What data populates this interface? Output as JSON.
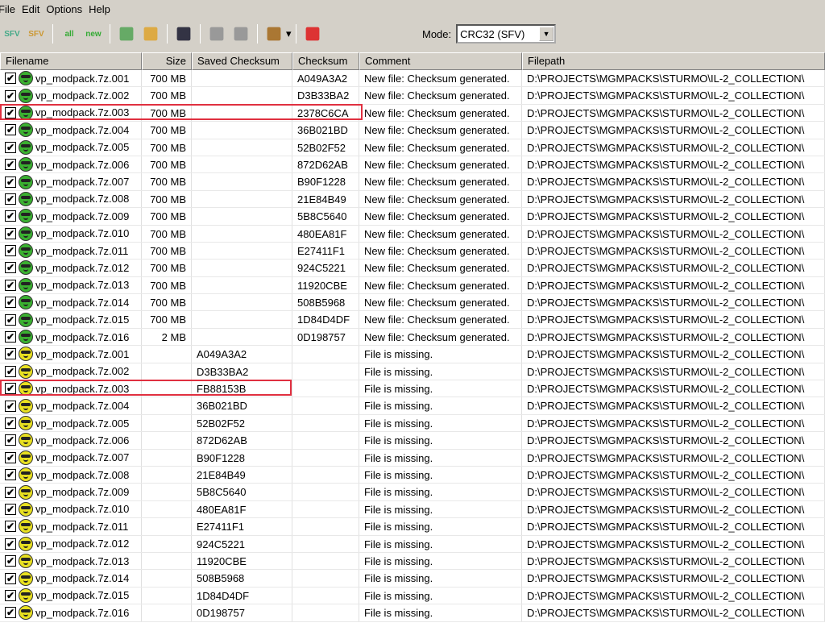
{
  "menu": [
    "File",
    "Edit",
    "Options",
    "Help"
  ],
  "toolbar": {
    "buttons": [
      {
        "name": "new-sfv-icon",
        "label": "SFV"
      },
      {
        "name": "open-sfv-icon",
        "label": "SFV"
      },
      {
        "name": "check-all-icon",
        "label": "all"
      },
      {
        "name": "check-new-icon",
        "label": "new"
      },
      {
        "name": "add-files-icon",
        "label": ""
      },
      {
        "name": "add-folder-icon",
        "label": ""
      },
      {
        "name": "save-icon",
        "label": ""
      },
      {
        "name": "check-selected-icon",
        "label": ""
      },
      {
        "name": "uncheck-icon",
        "label": ""
      },
      {
        "name": "clean-icon",
        "label": ""
      },
      {
        "name": "pin-icon",
        "label": ""
      }
    ],
    "mode_label": "Mode:",
    "mode_value": "CRC32 (SFV)"
  },
  "columns": [
    "Filename",
    "Size",
    "Saved Checksum",
    "Checksum",
    "Comment",
    "Filepath"
  ],
  "colors": {
    "ok": "#3ab030",
    "missing": "#e8e020",
    "highlight": "#e03040"
  },
  "rows": [
    {
      "file": "vp_modpack.7z.001",
      "size": "700 MB",
      "saved": "",
      "checksum": "A049A3A2",
      "comment": "New file: Checksum generated.",
      "path": "D:\\PROJECTS\\MGMPACKS\\STURMO\\IL-2_COLLECTION\\",
      "status": "ok"
    },
    {
      "file": "vp_modpack.7z.002",
      "size": "700 MB",
      "saved": "",
      "checksum": "D3B33BA2",
      "comment": "New file: Checksum generated.",
      "path": "D:\\PROJECTS\\MGMPACKS\\STURMO\\IL-2_COLLECTION\\",
      "status": "ok"
    },
    {
      "file": "vp_modpack.7z.003",
      "size": "700 MB",
      "saved": "",
      "checksum": "2378C6CA",
      "comment": "New file: Checksum generated.",
      "path": "D:\\PROJECTS\\MGMPACKS\\STURMO\\IL-2_COLLECTION\\",
      "status": "ok",
      "hl": "wide"
    },
    {
      "file": "vp_modpack.7z.004",
      "size": "700 MB",
      "saved": "",
      "checksum": "36B021BD",
      "comment": "New file: Checksum generated.",
      "path": "D:\\PROJECTS\\MGMPACKS\\STURMO\\IL-2_COLLECTION\\",
      "status": "ok"
    },
    {
      "file": "vp_modpack.7z.005",
      "size": "700 MB",
      "saved": "",
      "checksum": "52B02F52",
      "comment": "New file: Checksum generated.",
      "path": "D:\\PROJECTS\\MGMPACKS\\STURMO\\IL-2_COLLECTION\\",
      "status": "ok"
    },
    {
      "file": "vp_modpack.7z.006",
      "size": "700 MB",
      "saved": "",
      "checksum": "872D62AB",
      "comment": "New file: Checksum generated.",
      "path": "D:\\PROJECTS\\MGMPACKS\\STURMO\\IL-2_COLLECTION\\",
      "status": "ok"
    },
    {
      "file": "vp_modpack.7z.007",
      "size": "700 MB",
      "saved": "",
      "checksum": "B90F1228",
      "comment": "New file: Checksum generated.",
      "path": "D:\\PROJECTS\\MGMPACKS\\STURMO\\IL-2_COLLECTION\\",
      "status": "ok"
    },
    {
      "file": "vp_modpack.7z.008",
      "size": "700 MB",
      "saved": "",
      "checksum": "21E84B49",
      "comment": "New file: Checksum generated.",
      "path": "D:\\PROJECTS\\MGMPACKS\\STURMO\\IL-2_COLLECTION\\",
      "status": "ok"
    },
    {
      "file": "vp_modpack.7z.009",
      "size": "700 MB",
      "saved": "",
      "checksum": "5B8C5640",
      "comment": "New file: Checksum generated.",
      "path": "D:\\PROJECTS\\MGMPACKS\\STURMO\\IL-2_COLLECTION\\",
      "status": "ok"
    },
    {
      "file": "vp_modpack.7z.010",
      "size": "700 MB",
      "saved": "",
      "checksum": "480EA81F",
      "comment": "New file: Checksum generated.",
      "path": "D:\\PROJECTS\\MGMPACKS\\STURMO\\IL-2_COLLECTION\\",
      "status": "ok"
    },
    {
      "file": "vp_modpack.7z.011",
      "size": "700 MB",
      "saved": "",
      "checksum": "E27411F1",
      "comment": "New file: Checksum generated.",
      "path": "D:\\PROJECTS\\MGMPACKS\\STURMO\\IL-2_COLLECTION\\",
      "status": "ok"
    },
    {
      "file": "vp_modpack.7z.012",
      "size": "700 MB",
      "saved": "",
      "checksum": "924C5221",
      "comment": "New file: Checksum generated.",
      "path": "D:\\PROJECTS\\MGMPACKS\\STURMO\\IL-2_COLLECTION\\",
      "status": "ok"
    },
    {
      "file": "vp_modpack.7z.013",
      "size": "700 MB",
      "saved": "",
      "checksum": "11920CBE",
      "comment": "New file: Checksum generated.",
      "path": "D:\\PROJECTS\\MGMPACKS\\STURMO\\IL-2_COLLECTION\\",
      "status": "ok"
    },
    {
      "file": "vp_modpack.7z.014",
      "size": "700 MB",
      "saved": "",
      "checksum": "508B5968",
      "comment": "New file: Checksum generated.",
      "path": "D:\\PROJECTS\\MGMPACKS\\STURMO\\IL-2_COLLECTION\\",
      "status": "ok"
    },
    {
      "file": "vp_modpack.7z.015",
      "size": "700 MB",
      "saved": "",
      "checksum": "1D84D4DF",
      "comment": "New file: Checksum generated.",
      "path": "D:\\PROJECTS\\MGMPACKS\\STURMO\\IL-2_COLLECTION\\",
      "status": "ok"
    },
    {
      "file": "vp_modpack.7z.016",
      "size": "2 MB",
      "saved": "",
      "checksum": "0D198757",
      "comment": "New file: Checksum generated.",
      "path": "D:\\PROJECTS\\MGMPACKS\\STURMO\\IL-2_COLLECTION\\",
      "status": "ok"
    },
    {
      "file": "vp_modpack.7z.001",
      "size": "",
      "saved": "A049A3A2",
      "checksum": "",
      "comment": "File is missing.",
      "path": "D:\\PROJECTS\\MGMPACKS\\STURMO\\IL-2_COLLECTION\\",
      "status": "missing"
    },
    {
      "file": "vp_modpack.7z.002",
      "size": "",
      "saved": "D3B33BA2",
      "checksum": "",
      "comment": "File is missing.",
      "path": "D:\\PROJECTS\\MGMPACKS\\STURMO\\IL-2_COLLECTION\\",
      "status": "missing"
    },
    {
      "file": "vp_modpack.7z.003",
      "size": "",
      "saved": "FB88153B",
      "checksum": "",
      "comment": "File is missing.",
      "path": "D:\\PROJECTS\\MGMPACKS\\STURMO\\IL-2_COLLECTION\\",
      "status": "missing",
      "hl": "narrow"
    },
    {
      "file": "vp_modpack.7z.004",
      "size": "",
      "saved": "36B021BD",
      "checksum": "",
      "comment": "File is missing.",
      "path": "D:\\PROJECTS\\MGMPACKS\\STURMO\\IL-2_COLLECTION\\",
      "status": "missing"
    },
    {
      "file": "vp_modpack.7z.005",
      "size": "",
      "saved": "52B02F52",
      "checksum": "",
      "comment": "File is missing.",
      "path": "D:\\PROJECTS\\MGMPACKS\\STURMO\\IL-2_COLLECTION\\",
      "status": "missing"
    },
    {
      "file": "vp_modpack.7z.006",
      "size": "",
      "saved": "872D62AB",
      "checksum": "",
      "comment": "File is missing.",
      "path": "D:\\PROJECTS\\MGMPACKS\\STURMO\\IL-2_COLLECTION\\",
      "status": "missing"
    },
    {
      "file": "vp_modpack.7z.007",
      "size": "",
      "saved": "B90F1228",
      "checksum": "",
      "comment": "File is missing.",
      "path": "D:\\PROJECTS\\MGMPACKS\\STURMO\\IL-2_COLLECTION\\",
      "status": "missing"
    },
    {
      "file": "vp_modpack.7z.008",
      "size": "",
      "saved": "21E84B49",
      "checksum": "",
      "comment": "File is missing.",
      "path": "D:\\PROJECTS\\MGMPACKS\\STURMO\\IL-2_COLLECTION\\",
      "status": "missing"
    },
    {
      "file": "vp_modpack.7z.009",
      "size": "",
      "saved": "5B8C5640",
      "checksum": "",
      "comment": "File is missing.",
      "path": "D:\\PROJECTS\\MGMPACKS\\STURMO\\IL-2_COLLECTION\\",
      "status": "missing"
    },
    {
      "file": "vp_modpack.7z.010",
      "size": "",
      "saved": "480EA81F",
      "checksum": "",
      "comment": "File is missing.",
      "path": "D:\\PROJECTS\\MGMPACKS\\STURMO\\IL-2_COLLECTION\\",
      "status": "missing"
    },
    {
      "file": "vp_modpack.7z.011",
      "size": "",
      "saved": "E27411F1",
      "checksum": "",
      "comment": "File is missing.",
      "path": "D:\\PROJECTS\\MGMPACKS\\STURMO\\IL-2_COLLECTION\\",
      "status": "missing"
    },
    {
      "file": "vp_modpack.7z.012",
      "size": "",
      "saved": "924C5221",
      "checksum": "",
      "comment": "File is missing.",
      "path": "D:\\PROJECTS\\MGMPACKS\\STURMO\\IL-2_COLLECTION\\",
      "status": "missing"
    },
    {
      "file": "vp_modpack.7z.013",
      "size": "",
      "saved": "11920CBE",
      "checksum": "",
      "comment": "File is missing.",
      "path": "D:\\PROJECTS\\MGMPACKS\\STURMO\\IL-2_COLLECTION\\",
      "status": "missing"
    },
    {
      "file": "vp_modpack.7z.014",
      "size": "",
      "saved": "508B5968",
      "checksum": "",
      "comment": "File is missing.",
      "path": "D:\\PROJECTS\\MGMPACKS\\STURMO\\IL-2_COLLECTION\\",
      "status": "missing"
    },
    {
      "file": "vp_modpack.7z.015",
      "size": "",
      "saved": "1D84D4DF",
      "checksum": "",
      "comment": "File is missing.",
      "path": "D:\\PROJECTS\\MGMPACKS\\STURMO\\IL-2_COLLECTION\\",
      "status": "missing"
    },
    {
      "file": "vp_modpack.7z.016",
      "size": "",
      "saved": "0D198757",
      "checksum": "",
      "comment": "File is missing.",
      "path": "D:\\PROJECTS\\MGMPACKS\\STURMO\\IL-2_COLLECTION\\",
      "status": "missing"
    }
  ]
}
